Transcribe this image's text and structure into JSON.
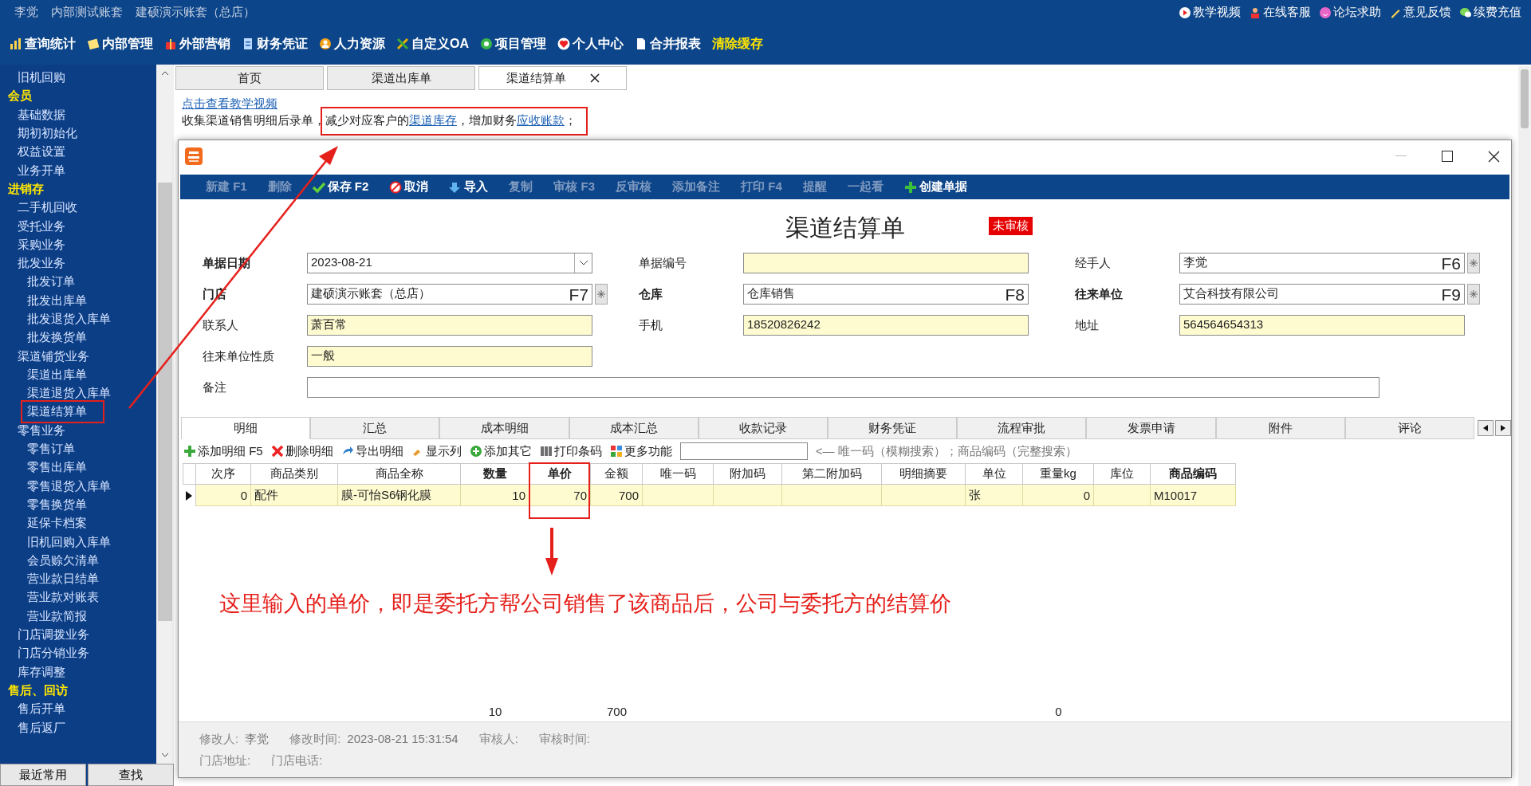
{
  "header": {
    "account_texts": [
      "李觉",
      "内部测试账套",
      "建硕演示账套（总店）"
    ],
    "links": [
      {
        "label": "教学视频",
        "kind": "play"
      },
      {
        "label": "在线客服",
        "kind": "service"
      },
      {
        "label": "论坛求助",
        "kind": "forum"
      },
      {
        "label": "意见反馈",
        "kind": "pen"
      },
      {
        "label": "续费充值",
        "kind": "chat"
      }
    ],
    "menu": [
      {
        "label": "查询统计",
        "kind": "chart"
      },
      {
        "label": "内部管理",
        "kind": "note"
      },
      {
        "label": "外部营销",
        "kind": "gift"
      },
      {
        "label": "财务凭证",
        "kind": "doc"
      },
      {
        "label": "人力资源",
        "kind": "person"
      },
      {
        "label": "自定义OA",
        "kind": "tools"
      },
      {
        "label": "项目管理",
        "kind": "ring"
      },
      {
        "label": "个人中心",
        "kind": "heart"
      },
      {
        "label": "合并报表",
        "kind": "page"
      },
      {
        "label": "清除缓存",
        "kind": "action"
      }
    ]
  },
  "sidebar": {
    "groups": [
      {
        "items": [
          {
            "label": "旧机回购",
            "marked": false
          }
        ]
      },
      {
        "title": "会员",
        "items": [
          {
            "label": "基础数据",
            "marked": false
          },
          {
            "label": "期初初始化",
            "marked": false
          },
          {
            "label": "权益设置",
            "marked": false
          },
          {
            "label": "业务开单",
            "marked": false
          }
        ]
      },
      {
        "title": "进销存",
        "items": [
          {
            "label": "二手机回收",
            "marked": false
          },
          {
            "label": "受托业务",
            "marked": false
          },
          {
            "label": "采购业务",
            "marked": false
          },
          {
            "label": "批发业务",
            "marked": false,
            "children": [
              {
                "label": "批发订单",
                "marked": false
              },
              {
                "label": "批发出库单",
                "marked": false
              },
              {
                "label": "批发退货入库单",
                "marked": false
              },
              {
                "label": "批发换货单",
                "marked": false
              }
            ]
          },
          {
            "label": "渠道铺货业务",
            "marked": false,
            "children": [
              {
                "label": "渠道出库单",
                "marked": false
              },
              {
                "label": "渠道退货入库单",
                "marked": false
              },
              {
                "label": "渠道结算单",
                "marked": true
              }
            ]
          },
          {
            "label": "零售业务",
            "marked": false,
            "children": [
              {
                "label": "零售订单",
                "marked": false
              },
              {
                "label": "零售出库单",
                "marked": false
              },
              {
                "label": "零售退货入库单",
                "marked": false
              },
              {
                "label": "零售换货单",
                "marked": false
              },
              {
                "label": "延保卡档案",
                "marked": false
              },
              {
                "label": "旧机回购入库单",
                "marked": false
              },
              {
                "label": "会员赊欠清单",
                "marked": false
              },
              {
                "label": "营业款日结单",
                "marked": false
              },
              {
                "label": "营业款对账表",
                "marked": false
              },
              {
                "label": "营业款简报",
                "marked": false
              }
            ]
          },
          {
            "label": "门店调拨业务",
            "marked": false
          },
          {
            "label": "门店分销业务",
            "marked": false
          },
          {
            "label": "库存调整",
            "marked": false
          }
        ]
      },
      {
        "title": "售后、回访",
        "items": [
          {
            "label": "售后开单",
            "marked": false
          },
          {
            "label": "售后返厂",
            "marked": false
          }
        ]
      }
    ],
    "buttons": [
      "最近常用",
      "查找"
    ]
  },
  "page_tabs": [
    {
      "label": "首页",
      "selected": false
    },
    {
      "label": "渠道出库单",
      "selected": false
    },
    {
      "label": "渠道结算单",
      "selected": true
    }
  ],
  "intro": {
    "link": "点击查看教学视频",
    "lead": "收集渠道销售明细后录单，",
    "marked": true,
    "boxed": [
      {
        "text": "减少对应客户的",
        "kind": "plain"
      },
      {
        "text": "渠道库存",
        "kind": "link"
      },
      {
        "text": "，增加财务",
        "kind": "plain"
      },
      {
        "text": "应收账款",
        "kind": "link"
      },
      {
        "text": "；",
        "kind": "plain"
      }
    ]
  },
  "dialog": {
    "toolbar": [
      {
        "label": "新建 F1",
        "kind": "text",
        "disabled": true
      },
      {
        "label": "删除",
        "kind": "text",
        "disabled": true
      },
      {
        "label": "保存 F2",
        "kind": "save",
        "disabled": false
      },
      {
        "label": "取消",
        "kind": "cancel",
        "disabled": false
      },
      {
        "label": "导入",
        "kind": "import",
        "disabled": false
      },
      {
        "label": "复制",
        "kind": "text",
        "disabled": true
      },
      {
        "label": "审核 F3",
        "kind": "text",
        "disabled": true
      },
      {
        "label": "反审核",
        "kind": "text",
        "disabled": true
      },
      {
        "label": "添加备注",
        "kind": "text",
        "disabled": true
      },
      {
        "label": "打印 F4",
        "kind": "text",
        "disabled": true
      },
      {
        "label": "提醒",
        "kind": "text",
        "disabled": true
      },
      {
        "label": "一起看",
        "kind": "text",
        "disabled": true
      },
      {
        "label": "创建单据",
        "kind": "create",
        "disabled": false
      }
    ],
    "title": "渠道结算单",
    "status": "未审核",
    "form_rows": [
      [
        {
          "label": "单据日期",
          "required": true,
          "kind": "date",
          "value": "2023-08-21",
          "highlighted": false,
          "picker": false
        },
        {
          "label": "单据编号",
          "required": false,
          "kind": "text",
          "highlighted": true,
          "picker": false
        },
        {
          "label": "经手人",
          "required": false,
          "kind": "lookup",
          "value": "李觉",
          "hotkey": "F6",
          "highlighted": false,
          "picker": true
        }
      ],
      [
        {
          "label": "门店",
          "required": true,
          "kind": "lookup",
          "value": "建硕演示账套（总店）",
          "hotkey": "F7",
          "highlighted": false,
          "picker": true
        },
        {
          "label": "仓库",
          "required": true,
          "kind": "lookup",
          "value": "仓库销售",
          "hotkey": "F8",
          "highlighted": false,
          "picker": false
        },
        {
          "label": "往来单位",
          "required": true,
          "kind": "lookup",
          "value": "艾合科技有限公司",
          "hotkey": "F9",
          "highlighted": false,
          "picker": true
        }
      ],
      [
        {
          "label": "联系人",
          "required": false,
          "kind": "text",
          "value": "萧百常",
          "highlighted": true,
          "picker": false
        },
        {
          "label": "手机",
          "required": false,
          "kind": "text",
          "value": "18520826242",
          "highlighted": true,
          "picker": false
        },
        {
          "label": "地址",
          "required": false,
          "kind": "text",
          "value": "564564654313",
          "highlighted": true,
          "picker": false
        }
      ],
      [
        {
          "label": "往来单位性质",
          "required": false,
          "kind": "text",
          "value": "一般",
          "highlighted": true,
          "picker": false
        }
      ],
      [
        {
          "label": "备注",
          "required": false,
          "kind": "wide",
          "highlighted": false,
          "picker": false
        }
      ]
    ],
    "tabs": [
      {
        "label": "明细",
        "selected": true
      },
      {
        "label": "汇总",
        "selected": false
      },
      {
        "label": "成本明细",
        "selected": false
      },
      {
        "label": "成本汇总",
        "selected": false
      },
      {
        "label": "收款记录",
        "selected": false
      },
      {
        "label": "财务凭证",
        "selected": false
      },
      {
        "label": "流程审批",
        "selected": false
      },
      {
        "label": "发票申请",
        "selected": false
      },
      {
        "label": "附件",
        "selected": false
      },
      {
        "label": "评论",
        "selected": false
      }
    ],
    "detail_toolbar": [
      {
        "label": "添加明细 F5",
        "kind": "add"
      },
      {
        "label": "删除明细",
        "kind": "delete"
      },
      {
        "label": "导出明细",
        "kind": "export"
      },
      {
        "label": "显示列",
        "kind": "columns"
      },
      {
        "label": "添加其它",
        "kind": "add-other"
      },
      {
        "label": "打印条码",
        "kind": "barcode"
      },
      {
        "label": "更多功能",
        "kind": "more"
      }
    ],
    "search_hint": "<— 唯一码（模糊搜索）；商品编码（完整搜索）",
    "columns": [
      {
        "label": "次序",
        "kind": "number",
        "emphasized": false,
        "marked": false
      },
      {
        "label": "商品类别",
        "kind": "text",
        "emphasized": false,
        "marked": false
      },
      {
        "label": "商品全称",
        "kind": "text",
        "emphasized": false,
        "marked": false
      },
      {
        "label": "数量",
        "kind": "number",
        "emphasized": true,
        "marked": false,
        "total": "10"
      },
      {
        "label": "单价",
        "kind": "number",
        "emphasized": true,
        "marked": true
      },
      {
        "label": "金额",
        "kind": "number",
        "emphasized": false,
        "marked": false,
        "total": "700"
      },
      {
        "label": "唯一码",
        "kind": "text",
        "emphasized": false,
        "marked": false
      },
      {
        "label": "附加码",
        "kind": "text",
        "emphasized": false,
        "marked": false
      },
      {
        "label": "第二附加码",
        "kind": "text",
        "emphasized": false,
        "marked": false
      },
      {
        "label": "明细摘要",
        "kind": "text",
        "emphasized": false,
        "marked": false
      },
      {
        "label": "单位",
        "kind": "text",
        "emphasized": false,
        "marked": false
      },
      {
        "label": "重量kg",
        "kind": "number",
        "emphasized": false,
        "marked": false,
        "total": "0"
      },
      {
        "label": "库位",
        "kind": "text",
        "emphasized": false,
        "marked": false
      },
      {
        "label": "商品编码",
        "kind": "text",
        "emphasized": true,
        "marked": false
      }
    ],
    "rows": [
      {
        "selected": true,
        "cells": [
          "0",
          "配件",
          "膜-可怡S6钢化膜",
          "10",
          "70",
          "700",
          null,
          null,
          null,
          null,
          "张",
          "0",
          null,
          "M10017"
        ]
      }
    ],
    "note": "这里输入的单价，即是委托方帮公司销售了该商品后，公司与委托方的结算价",
    "footer": [
      [
        {
          "label": "修改人:",
          "value": "李觉"
        },
        {
          "label": "修改时间:",
          "value": "2023-08-21 15:31:54"
        },
        {
          "label": "审核人:"
        },
        {
          "label": "审核时间:"
        }
      ],
      [
        {
          "label": "门店地址:"
        },
        {
          "label": "门店电话:"
        }
      ]
    ]
  }
}
